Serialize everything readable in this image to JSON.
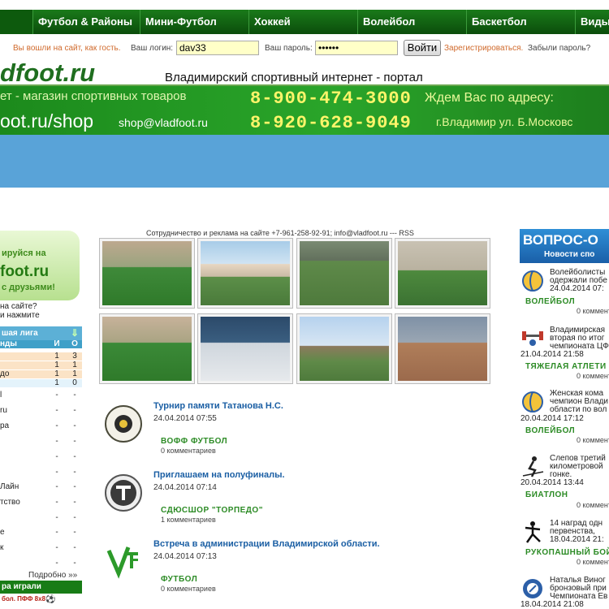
{
  "nav": {
    "items": [
      "Футбол & Районы",
      "Мини-Футбол",
      "Хоккей",
      "Волейбол",
      "Баскетбол",
      "Виды"
    ]
  },
  "login": {
    "guest_text": "Вы вошли на сайт, как гость.",
    "login_label": "Ваш логин:",
    "login_value": "dav33",
    "password_label": "Ваш пароль:",
    "password_value": "••••••",
    "submit": "Войти",
    "register": "Зарегистрироваться.",
    "forgot": "Забыли пароль?"
  },
  "header": {
    "logo": "dfoot.ru",
    "tagline": "Владимирский спортивный интернет - портал"
  },
  "banner": {
    "shop_line": "ет - магазин спортивных товаров",
    "shop_url": "oot.ru/shop",
    "email": "shop@vladfoot.ru",
    "phone1": "8-900-474-3000",
    "phone2": "8-920-628-9049",
    "invite": "Ждем Вас по адресу:",
    "address": "г.Владимир ул. Б.Московс"
  },
  "left": {
    "reg_line1": "ируйся на",
    "reg_line2": "foot.ru",
    "reg_line3": "с друзьями!",
    "note1": "на сайте?",
    "note2": "и нажмите",
    "league_title": "шая лига",
    "table_header": {
      "name": "нды",
      "c1": "И",
      "c2": "О"
    },
    "table_rows": [
      {
        "name": "",
        "c1": "1",
        "c2": "3"
      },
      {
        "name": "",
        "c1": "1",
        "c2": "1"
      },
      {
        "name": "до",
        "c1": "1",
        "c2": "1"
      },
      {
        "name": "",
        "c1": "1",
        "c2": "0"
      }
    ],
    "table_rows2": [
      {
        "name": "l",
        "c1": "-",
        "c2": "-"
      },
      {
        "name": "ru",
        "c1": "-",
        "c2": "-"
      },
      {
        "name": "ра",
        "c1": "-",
        "c2": "-"
      },
      {
        "name": "",
        "c1": "-",
        "c2": "-"
      },
      {
        "name": "",
        "c1": "-",
        "c2": "-"
      },
      {
        "name": "",
        "c1": "-",
        "c2": "-"
      },
      {
        "name": "Лайн",
        "c1": "-",
        "c2": "-"
      },
      {
        "name": "тство",
        "c1": "-",
        "c2": "-"
      },
      {
        "name": "",
        "c1": "-",
        "c2": "-"
      },
      {
        "name": "е",
        "c1": "-",
        "c2": "-"
      },
      {
        "name": "к",
        "c1": "-",
        "c2": "-"
      },
      {
        "name": "",
        "c1": "-",
        "c2": "-"
      }
    ],
    "more": "Подробно »»",
    "played_title": "ра играли",
    "played_row": "бол. ПФФ 8х8"
  },
  "center": {
    "coop": "Сотрудничество и реклама на сайте +7-961-258-92-91; info@vladfoot.ru --- RSS",
    "news": [
      {
        "title": "Турнир памяти Татанова Н.С.",
        "date": "24.04.2014 07:55",
        "category": "ВОФФ ФУТБОЛ",
        "comments": "0 комментариев"
      },
      {
        "title": "Приглашаем на полуфиналы.",
        "date": "24.04.2014 07:14",
        "category": "СДЮСШОР \"ТОРПЕДО\"",
        "comments": "1 комментариев"
      },
      {
        "title": "Встреча в администрации Владимирской области.",
        "date": "24.04.2014 07:13",
        "category": "ФУТБОЛ",
        "comments": "0 комментариев"
      }
    ]
  },
  "right": {
    "vopros_title": "ВОПРОС-О",
    "vopros_sub": "Новости спо",
    "news": [
      {
        "lines": [
          "Волейболисты",
          "одержали побе",
          "24.04.2014 07:"
        ],
        "date": "",
        "category": "ВОЛЕЙБОЛ",
        "comments": "0 коммент"
      },
      {
        "lines": [
          "Владимирская",
          "вторая по итог",
          "чемпионата ЦФ"
        ],
        "date": "21.04.2014 21:58",
        "category": "ТЯЖЕЛАЯ АТЛЕТИ",
        "comments": "0 коммент"
      },
      {
        "lines": [
          "Женская кома",
          "чемпион Влади",
          "области по вол"
        ],
        "date": "20.04.2014 17:12",
        "category": "ВОЛЕЙБОЛ",
        "comments": "0 коммент"
      },
      {
        "lines": [
          "Слепов третий",
          "километровой",
          "гонке."
        ],
        "date": "20.04.2014 13:44",
        "category": "БИАТЛОН",
        "comments": "0 коммент"
      },
      {
        "lines": [
          "14 наград одн",
          "первенства,",
          "18.04.2014 21:"
        ],
        "date": "",
        "category": "РУКОПАШНЫЙ БОЙ",
        "comments": "0 коммент"
      },
      {
        "lines": [
          "Наталья Виног",
          "бронзовый при",
          "Чемпионата Ев"
        ],
        "date": "18.04.2014 21:08",
        "category": "",
        "comments": ""
      }
    ]
  },
  "colors": {
    "nav_bg": "#0d5a0d",
    "banner_green": "#2aa52a",
    "blue_bar": "#59a3d8",
    "link_blue": "#1b5fa4",
    "category_green": "#2c8b25",
    "accent_orange": "#d06a2c"
  }
}
